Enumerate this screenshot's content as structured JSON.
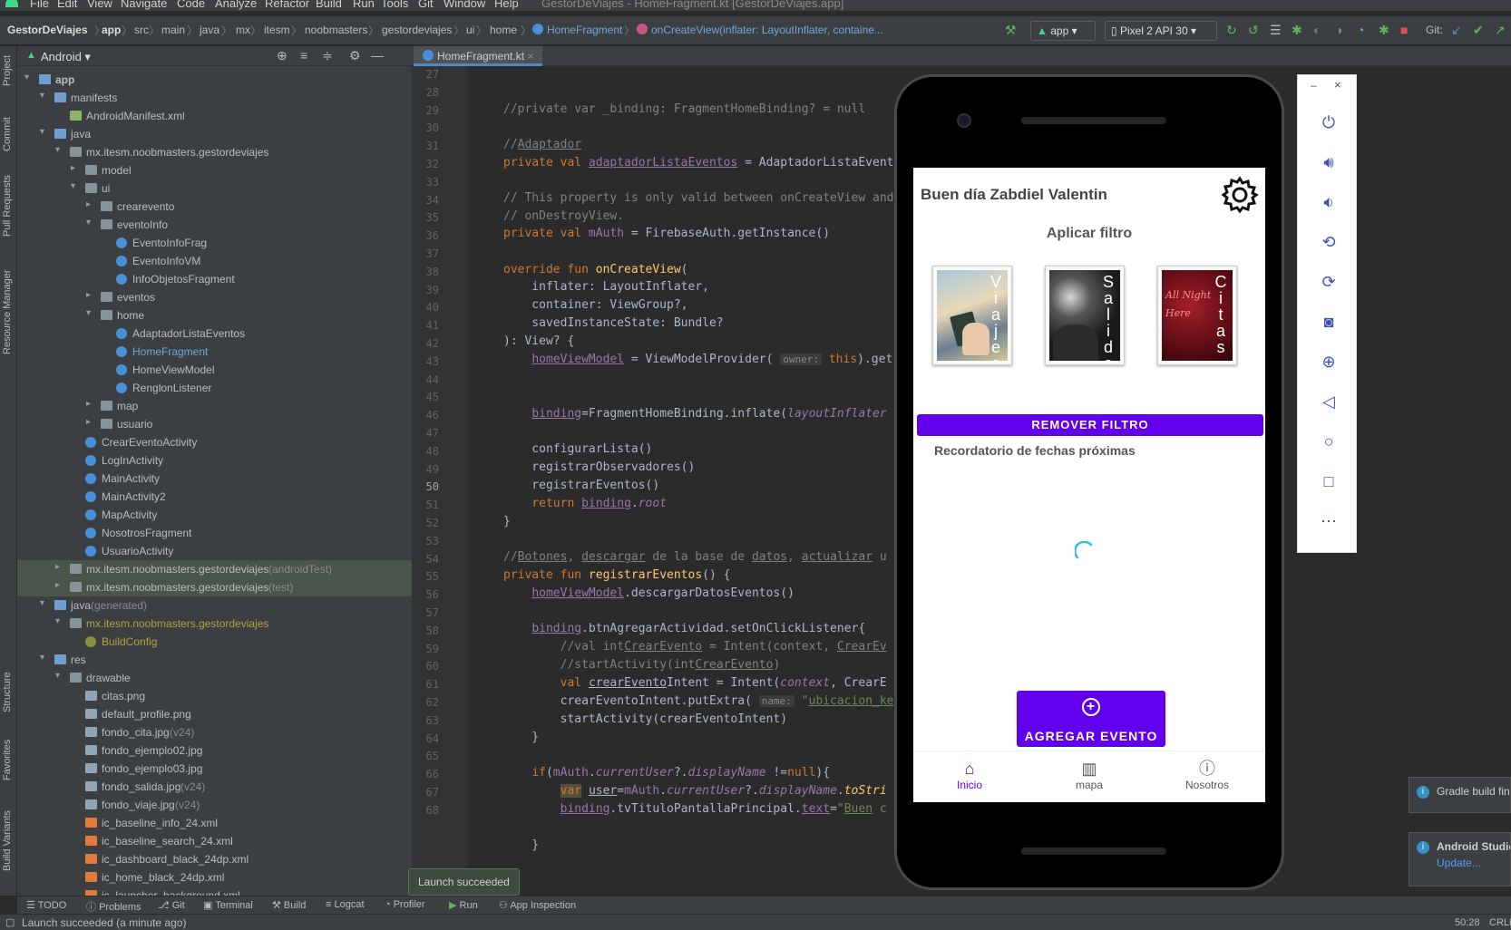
{
  "menu": [
    "File",
    "Edit",
    "View",
    "Navigate",
    "Code",
    "Analyze",
    "Refactor",
    "Build",
    "Run",
    "Tools",
    "Git",
    "Window",
    "Help"
  ],
  "window_title": "GestorDeViajes - HomeFragment.kt [GestorDeViajes.app]",
  "breadcrumb": [
    "GestorDeViajes",
    "app",
    "src",
    "main",
    "java",
    "mx",
    "itesm",
    "noobmasters",
    "gestordeviajes",
    "ui",
    "home",
    "HomeFragment",
    "onCreateView(inflater: LayoutInflater, containe..."
  ],
  "run_config": "app",
  "device": "Pixel 2 API 30",
  "git_label": "Git:",
  "left_tabs": [
    "Project",
    "Commit",
    "Pull Requests",
    "Resource Manager",
    "Structure",
    "Favorites",
    "Build Variants"
  ],
  "project": {
    "view": "Android",
    "tree": [
      {
        "label": "app",
        "depth": 0,
        "arrow": "▾",
        "icon": "folderb",
        "bold": true
      },
      {
        "label": "manifests",
        "depth": 1,
        "arrow": "▾",
        "icon": "folderb"
      },
      {
        "label": "AndroidManifest.xml",
        "depth": 2,
        "icon": "manifest"
      },
      {
        "label": "java",
        "depth": 1,
        "arrow": "▾",
        "icon": "folderb"
      },
      {
        "label": "mx.itesm.noobmasters.gestordeviajes",
        "depth": 2,
        "arrow": "▾",
        "icon": "folder"
      },
      {
        "label": "model",
        "depth": 3,
        "arrow": "▸",
        "icon": "folder"
      },
      {
        "label": "ui",
        "depth": 3,
        "arrow": "▾",
        "icon": "folder"
      },
      {
        "label": "crearevento",
        "depth": 4,
        "arrow": "▸",
        "icon": "folder"
      },
      {
        "label": "eventoInfo",
        "depth": 4,
        "arrow": "▾",
        "icon": "folder"
      },
      {
        "label": "EventoInfoFrag",
        "depth": 5,
        "icon": "kt"
      },
      {
        "label": "EventoInfoVM",
        "depth": 5,
        "icon": "kt"
      },
      {
        "label": "InfoObjetosFragment",
        "depth": 5,
        "icon": "kt"
      },
      {
        "label": "eventos",
        "depth": 4,
        "arrow": "▸",
        "icon": "folder"
      },
      {
        "label": "home",
        "depth": 4,
        "arrow": "▾",
        "icon": "folder"
      },
      {
        "label": "AdaptadorListaEventos",
        "depth": 5,
        "icon": "kt"
      },
      {
        "label": "HomeFragment",
        "depth": 5,
        "icon": "kt",
        "active": true
      },
      {
        "label": "HomeViewModel",
        "depth": 5,
        "icon": "kt"
      },
      {
        "label": "RenglonListener",
        "depth": 5,
        "icon": "kt"
      },
      {
        "label": "map",
        "depth": 4,
        "arrow": "▸",
        "icon": "folder"
      },
      {
        "label": "usuario",
        "depth": 4,
        "arrow": "▸",
        "icon": "folder"
      },
      {
        "label": "CrearEventoActivity",
        "depth": 3,
        "icon": "kt"
      },
      {
        "label": "LogInActivity",
        "depth": 3,
        "icon": "kt"
      },
      {
        "label": "MainActivity",
        "depth": 3,
        "icon": "kt"
      },
      {
        "label": "MainActivity2",
        "depth": 3,
        "icon": "kt"
      },
      {
        "label": "MapActivity",
        "depth": 3,
        "icon": "kt"
      },
      {
        "label": "NosotrosFragment",
        "depth": 3,
        "icon": "kt"
      },
      {
        "label": "UsuarioActivity",
        "depth": 3,
        "icon": "kt"
      },
      {
        "label": "mx.itesm.noobmasters.gestordeviajes",
        "suffix": " (androidTest)",
        "depth": 2,
        "arrow": "▸",
        "icon": "folder",
        "hl": true
      },
      {
        "label": "mx.itesm.noobmasters.gestordeviajes",
        "suffix": " (test)",
        "depth": 2,
        "arrow": "▸",
        "icon": "folder",
        "hl": true
      },
      {
        "label": "java",
        "suffix": " (generated)",
        "depth": 1,
        "arrow": "▾",
        "icon": "folderb"
      },
      {
        "label": "mx.itesm.noobmasters.gestordeviajes",
        "depth": 2,
        "arrow": "▾",
        "icon": "folder",
        "yellow": true
      },
      {
        "label": "BuildConfig",
        "depth": 3,
        "icon": "bc",
        "yellow": true
      },
      {
        "label": "res",
        "depth": 1,
        "arrow": "▾",
        "icon": "folderb"
      },
      {
        "label": "drawable",
        "depth": 2,
        "arrow": "▾",
        "icon": "folder"
      },
      {
        "label": "citas.png",
        "depth": 3,
        "icon": "png"
      },
      {
        "label": "default_profile.png",
        "depth": 3,
        "icon": "png"
      },
      {
        "label": "fondo_cita.jpg",
        "suffix": " (v24)",
        "depth": 3,
        "icon": "png"
      },
      {
        "label": "fondo_ejemplo02.jpg",
        "depth": 3,
        "icon": "png"
      },
      {
        "label": "fondo_ejemplo03.jpg",
        "depth": 3,
        "icon": "png"
      },
      {
        "label": "fondo_salida.jpg",
        "suffix": " (v24)",
        "depth": 3,
        "icon": "png"
      },
      {
        "label": "fondo_viaje.jpg",
        "suffix": " (v24)",
        "depth": 3,
        "icon": "png"
      },
      {
        "label": "ic_baseline_info_24.xml",
        "depth": 3,
        "icon": "xml"
      },
      {
        "label": "ic_baseline_search_24.xml",
        "depth": 3,
        "icon": "xml"
      },
      {
        "label": "ic_dashboard_black_24dp.xml",
        "depth": 3,
        "icon": "xml"
      },
      {
        "label": "ic_home_black_24dp.xml",
        "depth": 3,
        "icon": "xml"
      },
      {
        "label": "ic_launcher_background.xml",
        "depth": 3,
        "icon": "xml"
      }
    ]
  },
  "editor": {
    "tab": "HomeFragment.kt",
    "line_numbers": [
      "27",
      "28",
      "29",
      "30",
      "31",
      "32",
      "33",
      "34",
      "35",
      "36",
      "37",
      "38",
      "39",
      "40",
      "41",
      "42",
      "43",
      "44",
      "45",
      "46",
      "47",
      "48",
      "49",
      "50",
      "51",
      "52",
      "53",
      "54",
      "55",
      "56",
      "57",
      "58",
      "59",
      "60",
      "61",
      "62",
      "63",
      "64",
      "65",
      "66",
      "67",
      "68"
    ],
    "current_line": "50"
  },
  "phone": {
    "greeting": "Buen día Zabdiel Valentin",
    "filter_title": "Aplicar filtro",
    "cards": [
      {
        "text": "Viajes",
        "bg": "#8bb3cf"
      },
      {
        "text": "Salidas",
        "bg": "#2a2a2a"
      },
      {
        "text": "Citas",
        "bg": "#5a0d14"
      }
    ],
    "card_script": [
      "All Night",
      "Here"
    ],
    "remove_filter": "REMOVER FILTRO",
    "reminder": "Recordatorio de fechas próximas",
    "add_event": "AGREGAR EVENTO",
    "nav": [
      {
        "label": "Inicio",
        "icon": "home-icon",
        "active": true
      },
      {
        "label": "mapa",
        "icon": "map-icon"
      },
      {
        "label": "Nosotros",
        "icon": "info-icon"
      }
    ],
    "accent": "#6200ee"
  },
  "bottom_tabs": [
    "TODO",
    "Problems",
    "Git",
    "Terminal",
    "Build",
    "Logcat",
    "Profiler",
    "Run",
    "App Inspection"
  ],
  "launch_tip": "Launch succeeded",
  "status": {
    "message": "Launch succeeded (a minute ago)",
    "position": "50:28",
    "encoding": "CRLF"
  },
  "notifications": [
    {
      "title": "Gradle build fin"
    },
    {
      "title": "Android Studio",
      "link": "Update..."
    }
  ]
}
